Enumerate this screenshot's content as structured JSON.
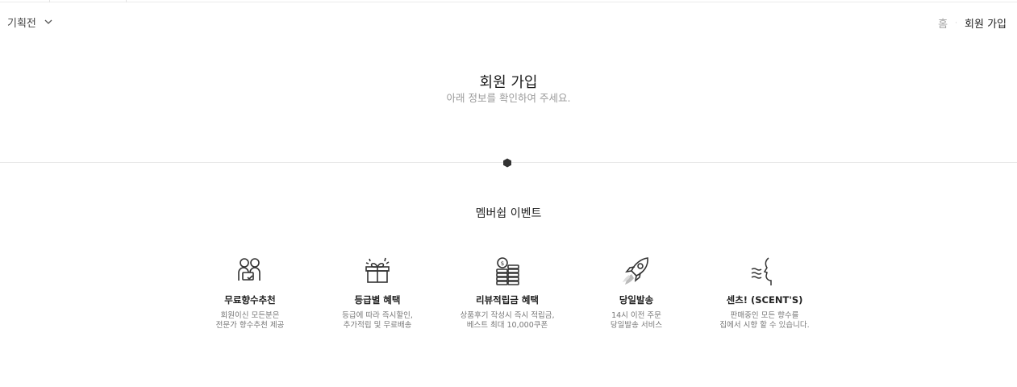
{
  "header": {
    "category_label": "기획전",
    "breadcrumb": {
      "home": "홈",
      "separator": "·",
      "current": "회원 가입"
    }
  },
  "hero": {
    "title": "회원 가입",
    "subtitle": "아래 정보를 확인하여 주세요."
  },
  "membership": {
    "title": "멤버쉽 이벤트",
    "benefits": [
      {
        "icon": "people-icon",
        "title": "무료향수추천",
        "desc_line1": "회원이신 모든분은",
        "desc_line2": "전문가 향수추천 제공"
      },
      {
        "icon": "gift-icon",
        "title": "등급별 혜택",
        "desc_line1": "등급에 따라 즉시할인,",
        "desc_line2": "추가적립 및 무료배송"
      },
      {
        "icon": "coins-icon",
        "title": "리뷰적립금 혜택",
        "desc_line1": "상품후기 작성시 즉시 적립금,",
        "desc_line2": "베스트 최대 10,000쿠폰"
      },
      {
        "icon": "rocket-icon",
        "title": "당일발송",
        "desc_line1": "14시 이전 주문",
        "desc_line2": "당일발송 서비스"
      },
      {
        "icon": "scent-face-icon",
        "title": "센츠! (SCENT'S)",
        "desc_line1": "판매중인 모든 향수를",
        "desc_line2": "집에서 시향 할 수 있습니다."
      }
    ]
  },
  "colors": {
    "text": "#222222",
    "muted": "#9a9a9a",
    "divider": "#e8e8e8",
    "marker": "#333333"
  }
}
